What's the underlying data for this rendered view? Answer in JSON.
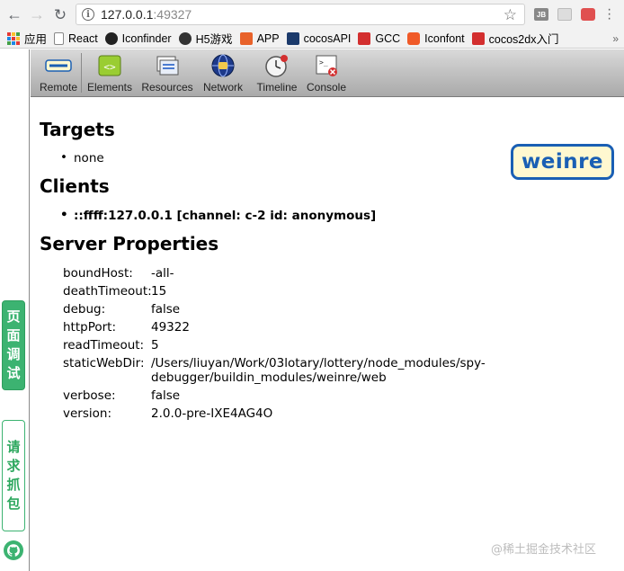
{
  "browser": {
    "url_host": "127.0.0.1",
    "url_port": ":49327",
    "ext1_label": "JB"
  },
  "bookmarks": [
    {
      "label": "应用",
      "icon": "apps-grid-icon"
    },
    {
      "label": "React",
      "icon": "page-icon"
    },
    {
      "label": "Iconfinder",
      "icon": "iconfinder-icon"
    },
    {
      "label": "H5游戏",
      "icon": "h5-game-icon"
    },
    {
      "label": "APP",
      "icon": "app-icon"
    },
    {
      "label": "cocosAPI",
      "icon": "cocos-api-icon"
    },
    {
      "label": "GCC",
      "icon": "gcc-icon"
    },
    {
      "label": "Iconfont",
      "icon": "iconfont-icon"
    },
    {
      "label": "cocos2dx入门",
      "icon": "cocos2dx-icon"
    }
  ],
  "side_widget": {
    "debug_label": [
      "页",
      "面",
      "调",
      "试"
    ],
    "capture_label": [
      "请",
      "求",
      "抓",
      "包"
    ]
  },
  "weinre_toolbar": {
    "remote": "Remote",
    "elements": "Elements",
    "resources": "Resources",
    "network": "Network",
    "timeline": "Timeline",
    "console": "Console"
  },
  "main": {
    "targets_heading": "Targets",
    "targets_item": "none",
    "clients_heading": "Clients",
    "clients_item": "::ffff:127.0.0.1 [channel: c-2 id: anonymous]",
    "server_heading": "Server Properties",
    "logo_text": "weinre",
    "properties": [
      {
        "key": "boundHost:",
        "value": "-all-"
      },
      {
        "key": "deathTimeout:",
        "value": "15"
      },
      {
        "key": "debug:",
        "value": "false"
      },
      {
        "key": "httpPort:",
        "value": "49322"
      },
      {
        "key": "readTimeout:",
        "value": "5"
      },
      {
        "key": "staticWebDir:",
        "value": "/Users/liuyan/Work/03lotary/lottery/node_modules/spy-debugger/buildin_modules/weinre/web"
      },
      {
        "key": "verbose:",
        "value": "false"
      },
      {
        "key": "version:",
        "value": "2.0.0-pre-IXE4AG4O"
      }
    ]
  },
  "watermark": "@稀土掘金技术社区",
  "colors": {
    "accent_green": "#3cb371",
    "weinre_blue": "#1a5fb4"
  }
}
